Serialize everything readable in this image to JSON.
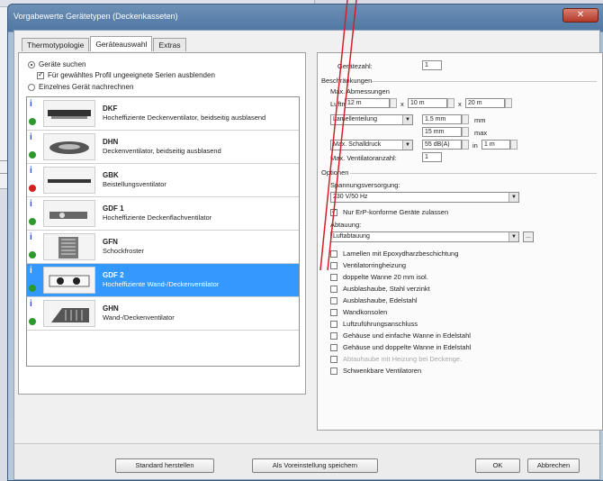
{
  "window": {
    "title": "Vorgabewerte Gerätetypen (Deckenkasseten)",
    "close": "✕"
  },
  "tabs": [
    "Thermotypologie",
    "Geräteauswahl",
    "Extras"
  ],
  "active_tab": 1,
  "search": {
    "radio_search": "Geräte suchen",
    "checkbox_filter": "Für gewähltes Profil ungeeignete Serien ausblenden",
    "radio_single": "Einzelnes Gerät nachrechnen"
  },
  "devices": [
    {
      "code": "DKF",
      "desc": "Hocheffiziente Deckenventilator, beidseitig ausblasend",
      "status": "green"
    },
    {
      "code": "DHN",
      "desc": "Deckenventilator, beidseitig ausblasend",
      "status": "green"
    },
    {
      "code": "GBK",
      "desc": "Beistellungsventilator",
      "status": "red"
    },
    {
      "code": "GDF 1",
      "desc": "Hocheffiziente Deckenflachventilator",
      "status": "green"
    },
    {
      "code": "GFN",
      "desc": "Schockfroster",
      "status": "green"
    },
    {
      "code": "GDF 2",
      "desc": "Hocheffiziente Wand-/Deckenventilator",
      "status": "green",
      "selected": true
    },
    {
      "code": "GHN",
      "desc": "Wand-/Deckenventilator",
      "status": "green"
    }
  ],
  "right": {
    "geraete_anzahl_label": "Gerätezahl:",
    "geraete_anzahl_value": "1",
    "einschraenkungen": "Beschränkungen",
    "max_abmessungen": "Max. Abmessungen",
    "laenge_label": "Luftm.",
    "laenge_value": "12 m",
    "breite_value": "10 m",
    "hoehe_value": "20 m",
    "x1": "x",
    "x2": "x",
    "lamellen_select": "Lamellenteilung",
    "lamellen_value": "1.5 mm",
    "unit_mm": "mm",
    "second_value": "15 mm",
    "max_label": "max",
    "druck_select": "Max. Schalldruck",
    "db_value": "55 dB(A)",
    "in_label": "in",
    "m_value": "1 m",
    "ventilatoren_label": "Max. Ventilatoranzahl:",
    "ventilatoren_value": "1",
    "optionen": "Optionen",
    "spannungsversorgung_label": "Spannungsversorgung:",
    "spannungsversorgung_value": "230 V/50 Hz",
    "erp_label": "Nur ErP-konforme Geräte zulassen",
    "abtauung_label": "Abtauung:",
    "abtauung_value": "Luftabtauung",
    "ellipsis": "..."
  },
  "options": [
    {
      "label": "Lamellen mit Epoxydharzbeschichtung",
      "disabled": false
    },
    {
      "label": "Ventilatorringheizung",
      "disabled": false
    },
    {
      "label": "doppelte Wanne 20 mm isol.",
      "disabled": false
    },
    {
      "label": "Ausblashaube, Stahl verzinkt",
      "disabled": false
    },
    {
      "label": "Ausblashaube, Edelstahl",
      "disabled": false
    },
    {
      "label": "Wandkonsolen",
      "disabled": false
    },
    {
      "label": "Luftzuführungsanschluss",
      "disabled": false
    },
    {
      "label": "Gehäuse und einfache Wanne in Edelstahl",
      "disabled": false
    },
    {
      "label": "Gehäuse und doppelte Wanne in Edelstahl",
      "disabled": false
    },
    {
      "label": "Abtauhaube mit Heizung bei Deckenge.",
      "disabled": true
    },
    {
      "label": "Schwenkbare Ventilatoren",
      "disabled": false
    }
  ],
  "footer": {
    "standard": "Standard herstellen",
    "save_default": "Als Voreinstellung speichern",
    "ok": "OK",
    "cancel": "Abbrechen"
  },
  "colors": {
    "selection": "#3399ff",
    "status_green": "#2e9a2e",
    "status_red": "#d32020",
    "annotation_red": "#d0202a"
  }
}
